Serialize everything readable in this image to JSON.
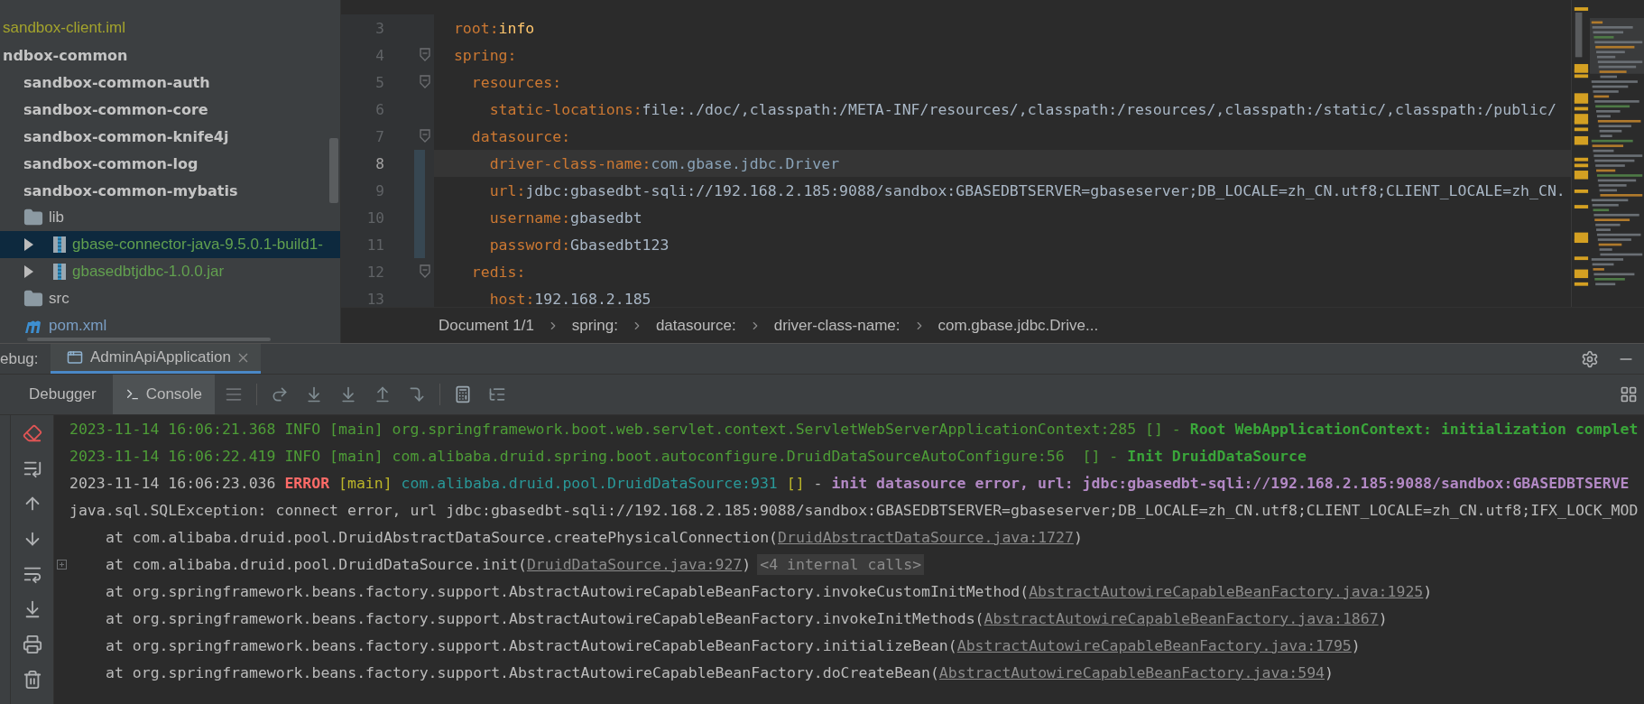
{
  "tree": {
    "items": [
      {
        "label": "sandbox-client.iml",
        "kind": "file",
        "color": "#a3a32c",
        "selected": false
      },
      {
        "label": "ndbox-common",
        "kind": "module",
        "color": "#c4c4c4",
        "selected": false,
        "children": [
          {
            "label": "sandbox-common-auth",
            "kind": "module",
            "color": "#c4c4c4",
            "selected": false
          },
          {
            "label": "sandbox-common-core",
            "kind": "module",
            "color": "#c4c4c4",
            "selected": false
          },
          {
            "label": "sandbox-common-knife4j",
            "kind": "module",
            "color": "#c4c4c4",
            "selected": false
          },
          {
            "label": "sandbox-common-log",
            "kind": "module",
            "color": "#c4c4c4",
            "selected": false
          },
          {
            "label": "sandbox-common-mybatis",
            "kind": "module",
            "color": "#c4c4c4",
            "selected": false
          },
          {
            "label": "lib",
            "kind": "folder",
            "color": "#bbbbbb",
            "selected": false,
            "children": [
              {
                "label": "gbase-connector-java-9.5.0.1-build1-",
                "kind": "jar",
                "color": "#62a04f",
                "selected": true,
                "expanded": false
              },
              {
                "label": "gbasedbtjdbc-1.0.0.jar",
                "kind": "jar",
                "color": "#62a04f",
                "selected": false,
                "expanded": false
              }
            ]
          },
          {
            "label": "src",
            "kind": "folder",
            "color": "#bbbbbb",
            "selected": false
          },
          {
            "label": "pom.xml",
            "kind": "maven",
            "color": "#7a9ec4",
            "selected": false
          }
        ]
      }
    ]
  },
  "editor": {
    "lines": [
      {
        "number": "3",
        "key": "root:",
        "value": "info",
        "kind": "keyword",
        "current": false,
        "changed": false
      },
      {
        "number": "4",
        "key": "spring:",
        "current": false,
        "changed": false,
        "children": [
          {
            "number": "5",
            "key": "resources:",
            "current": false,
            "changed": false,
            "children": [
              {
                "number": "6",
                "key": "static-locations:",
                "value": "file:./doc/,classpath:/META-INF/resources/,classpath:/resources/,classpath:/static/,classpath:/public/",
                "kind": "plain",
                "current": false,
                "changed": false
              }
            ]
          },
          {
            "number": "7",
            "key": "datasource:",
            "current": false,
            "changed": false,
            "children": [
              {
                "number": "8",
                "key": "driver-class-name:",
                "value": "com.gbase.jdbc.Driver",
                "kind": "reference",
                "current": true,
                "changed": true
              },
              {
                "number": "9",
                "key": "url:",
                "value": "jdbc:gbasedbt-sqli://192.168.2.185:9088/sandbox:GBASEDBTSERVER=gbaseserver;DB_LOCALE=zh_CN.utf8;CLIENT_LOCALE=zh_CN.",
                "kind": "plain",
                "current": false,
                "changed": true
              },
              {
                "number": "10",
                "key": "username:",
                "value": "gbasedbt",
                "kind": "plain",
                "current": false,
                "changed": true
              },
              {
                "number": "11",
                "key": "password:",
                "value": "Gbasedbt123",
                "kind": "plain",
                "current": false,
                "changed": true
              }
            ]
          },
          {
            "number": "12",
            "key": "redis:",
            "current": false,
            "changed": false,
            "children": [
              {
                "number": "13",
                "key": "host:",
                "value": "192.168.2.185",
                "kind": "plain",
                "current": false,
                "changed": false
              }
            ]
          }
        ]
      }
    ],
    "breadcrumbs": [
      "Document 1/1",
      "spring:",
      "datasource:",
      "driver-class-name:",
      "com.gbase.jdbc.Drive..."
    ]
  },
  "debug_panel": {
    "label": "ebug:",
    "tabs": [
      {
        "label": "AdminApiApplication",
        "selected": true
      }
    ],
    "tool_tabs": [
      {
        "label": "Debugger",
        "selected": false
      },
      {
        "label": "Console",
        "selected": true
      }
    ]
  },
  "console": {
    "lines": [
      {
        "kind": "log",
        "folded": false,
        "segments": [
          {
            "kind": "info",
            "text": "2023-11-14 16:06:21.368 INFO [main] org.springframework.boot.web.servlet.context.ServletWebServerApplicationContext:285 [] - "
          },
          {
            "kind": "info-message",
            "text": "Root WebApplicationContext: initialization complet"
          }
        ]
      },
      {
        "kind": "log",
        "folded": false,
        "segments": [
          {
            "kind": "info",
            "text": "2023-11-14 16:06:22.419 INFO [main] com.alibaba.druid.spring.boot.autoconfigure.DruidDataSourceAutoConfigure:56  [] - "
          },
          {
            "kind": "info-message",
            "text": "Init DruidDataSource"
          }
        ]
      },
      {
        "kind": "log",
        "folded": false,
        "segments": [
          {
            "kind": "plain",
            "text": "2023-11-14 16:06:23.036 "
          },
          {
            "kind": "error",
            "text": "ERROR"
          },
          {
            "kind": "thread",
            "text": " [main] "
          },
          {
            "kind": "logger",
            "text": "com.alibaba.druid.pool.DruidDataSource:931"
          },
          {
            "kind": "thread",
            "text": " [] "
          },
          {
            "kind": "plain",
            "text": "- "
          },
          {
            "kind": "error-message",
            "text": "init datasource error, url: jdbc:gbasedbt-sqli://192.168.2.185:9088/sandbox:GBASEDBTSERVE"
          }
        ]
      },
      {
        "kind": "log",
        "folded": false,
        "segments": [
          {
            "kind": "plain",
            "text": "java.sql.SQLException: connect error, url jdbc:gbasedbt-sqli://192.168.2.185:9088/sandbox:GBASEDBTSERVER=gbaseserver;DB_LOCALE=zh_CN.utf8;CLIENT_LOCALE=zh_CN.utf8;IFX_LOCK_MOD"
          }
        ]
      },
      {
        "kind": "frame",
        "folded": false,
        "segments": [
          {
            "kind": "plain",
            "text": "at com.alibaba.druid.pool.DruidAbstractDataSource.createPhysicalConnection("
          },
          {
            "kind": "link",
            "text": "DruidAbstractDataSource.java:1727"
          },
          {
            "kind": "plain",
            "text": ")"
          }
        ]
      },
      {
        "kind": "frame",
        "folded": true,
        "segments": [
          {
            "kind": "plain",
            "text": "at com.alibaba.druid.pool.DruidDataSource.init("
          },
          {
            "kind": "link",
            "text": "DruidDataSource.java:927"
          },
          {
            "kind": "plain",
            "text": ")"
          },
          {
            "kind": "badge",
            "text": "<4 internal calls>"
          }
        ]
      },
      {
        "kind": "frame",
        "folded": false,
        "segments": [
          {
            "kind": "plain",
            "text": "at org.springframework.beans.factory.support.AbstractAutowireCapableBeanFactory.invokeCustomInitMethod("
          },
          {
            "kind": "link",
            "text": "AbstractAutowireCapableBeanFactory.java:1925"
          },
          {
            "kind": "plain",
            "text": ")"
          }
        ]
      },
      {
        "kind": "frame",
        "folded": false,
        "segments": [
          {
            "kind": "plain",
            "text": "at org.springframework.beans.factory.support.AbstractAutowireCapableBeanFactory.invokeInitMethods("
          },
          {
            "kind": "link",
            "text": "AbstractAutowireCapableBeanFactory.java:1867"
          },
          {
            "kind": "plain",
            "text": ")"
          }
        ]
      },
      {
        "kind": "frame",
        "folded": false,
        "segments": [
          {
            "kind": "plain",
            "text": "at org.springframework.beans.factory.support.AbstractAutowireCapableBeanFactory.initializeBean("
          },
          {
            "kind": "link",
            "text": "AbstractAutowireCapableBeanFactory.java:1795"
          },
          {
            "kind": "plain",
            "text": ")"
          }
        ]
      },
      {
        "kind": "frame",
        "folded": false,
        "segments": [
          {
            "kind": "plain",
            "text": "at org.springframework.beans.factory.support.AbstractAutowireCapableBeanFactory.doCreateBean("
          },
          {
            "kind": "link",
            "text": "AbstractAutowireCapableBeanFactory.java:594"
          },
          {
            "kind": "plain",
            "text": ")"
          }
        ]
      }
    ]
  }
}
